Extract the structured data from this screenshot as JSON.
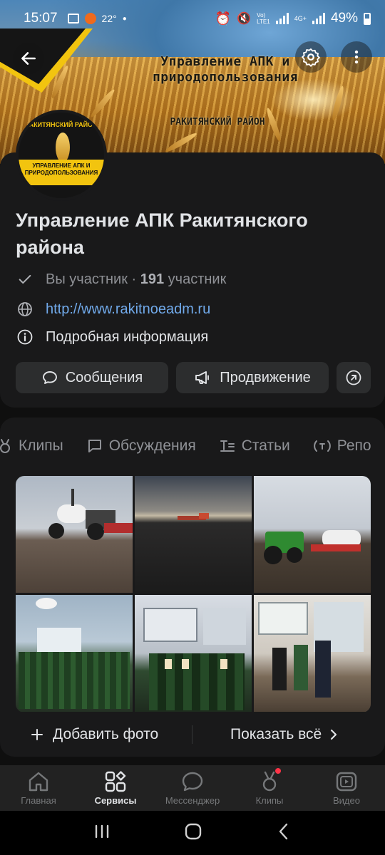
{
  "status_bar": {
    "time": "15:07",
    "temp": "22°",
    "battery": "49%",
    "net1": "Vo)\nLTE1",
    "net2": "4G+"
  },
  "cover": {
    "title": "Управление АПК и природопользования",
    "subtitle": "РАКИТЯНСКИЙ РАЙОН"
  },
  "avatar": {
    "top_text": "РАКИТЯНСКИЙ РАЙОН",
    "bottom_text": "УПРАВЛЕНИЕ АПК И ПРИРОДОПОЛЬЗОВАНИЯ"
  },
  "profile": {
    "name": "Управление АПК  Ракитянского района",
    "member_prefix": "Вы участник · ",
    "member_count": "191",
    "member_suffix": " участник",
    "website": "http://www.rakitnoeadm.ru",
    "details": "Подробная информация"
  },
  "buttons": {
    "messages": "Сообщения",
    "promotion": "Продвижение"
  },
  "tabs": [
    {
      "label": "Клипы",
      "icon": "clips-icon"
    },
    {
      "label": "Обсуждения",
      "icon": "discussion-icon"
    },
    {
      "label": "Статьи",
      "icon": "articles-icon"
    },
    {
      "label": "Репо",
      "icon": "podcast-icon"
    }
  ],
  "photos_actions": {
    "add": "Добавить фото",
    "show_all": "Показать всё"
  },
  "bottom_nav": [
    {
      "label": "Главная",
      "icon": "home-icon",
      "active": false
    },
    {
      "label": "Сервисы",
      "icon": "services-icon",
      "active": true
    },
    {
      "label": "Мессенджер",
      "icon": "messenger-icon",
      "active": false
    },
    {
      "label": "Клипы",
      "icon": "clips-icon",
      "active": false
    },
    {
      "label": "Видео",
      "icon": "video-icon",
      "active": false
    }
  ],
  "colors": {
    "accent_link": "#71aaeb",
    "badge": "#ff3347",
    "brand_yellow": "#f2c40f",
    "card": "#19191a"
  }
}
